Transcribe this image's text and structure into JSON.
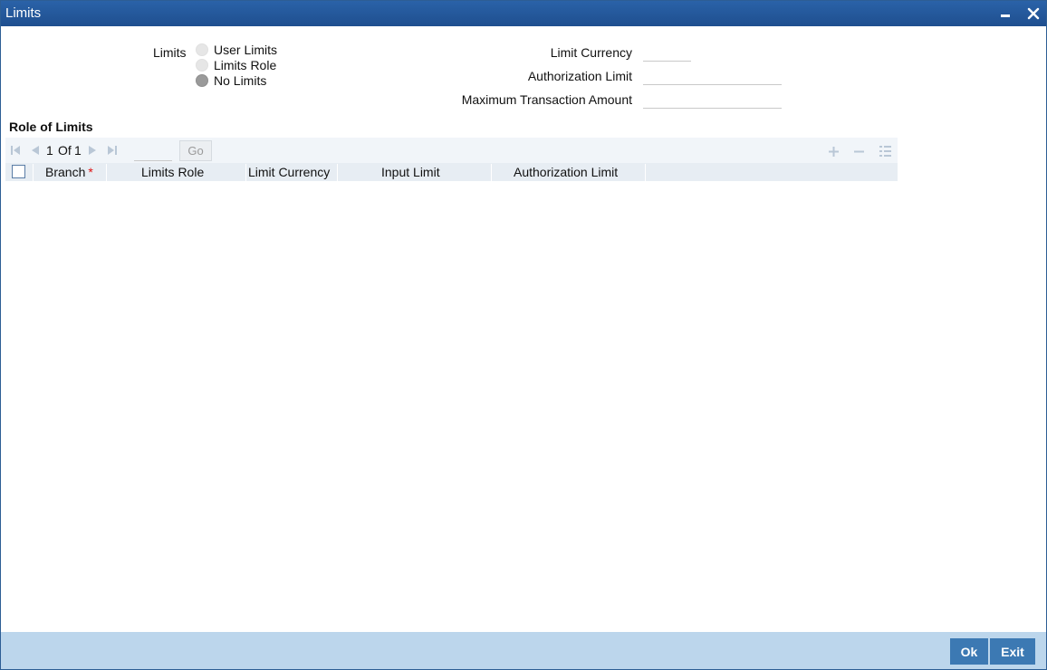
{
  "window": {
    "title": "Limits"
  },
  "limits": {
    "label": "Limits",
    "options": [
      {
        "label": "User Limits",
        "checked": false
      },
      {
        "label": "Limits Role",
        "checked": false
      },
      {
        "label": "No Limits",
        "checked": true
      }
    ]
  },
  "right_fields": {
    "limit_currency": {
      "label": "Limit Currency",
      "value": ""
    },
    "authorization_limit": {
      "label": "Authorization Limit",
      "value": ""
    },
    "max_txn_amount": {
      "label": "Maximum Transaction Amount",
      "value": ""
    }
  },
  "section": {
    "title": "Role of Limits"
  },
  "pager": {
    "current": "1",
    "of_label": "Of",
    "total": "1",
    "go_label": "Go",
    "page_input": ""
  },
  "columns": {
    "branch": "Branch",
    "required_mark": "*",
    "limits_role": "Limits Role",
    "limit_currency": "Limit Currency",
    "input_limit": "Input Limit",
    "authorization_limit": "Authorization Limit"
  },
  "footer": {
    "ok_label": "Ok",
    "exit_label": "Exit"
  }
}
